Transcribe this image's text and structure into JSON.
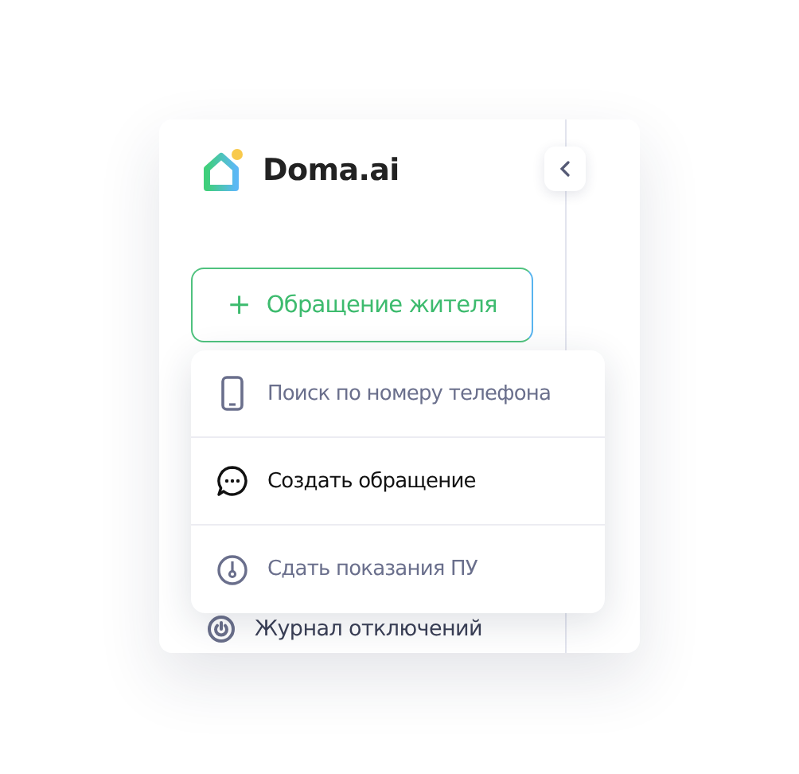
{
  "logo": {
    "text": "Doma.ai"
  },
  "new_request_button": {
    "icon": "+",
    "label": "Обращение жителя"
  },
  "menu": [
    {
      "kind": "phone",
      "label": "Поиск по номеру телефона",
      "selected": false
    },
    {
      "kind": "chat",
      "label": "Создать обращение",
      "selected": true
    },
    {
      "kind": "meter",
      "label": "Сдать показания ПУ",
      "selected": false
    }
  ],
  "nav_item": {
    "label": "Журнал отключений"
  }
}
